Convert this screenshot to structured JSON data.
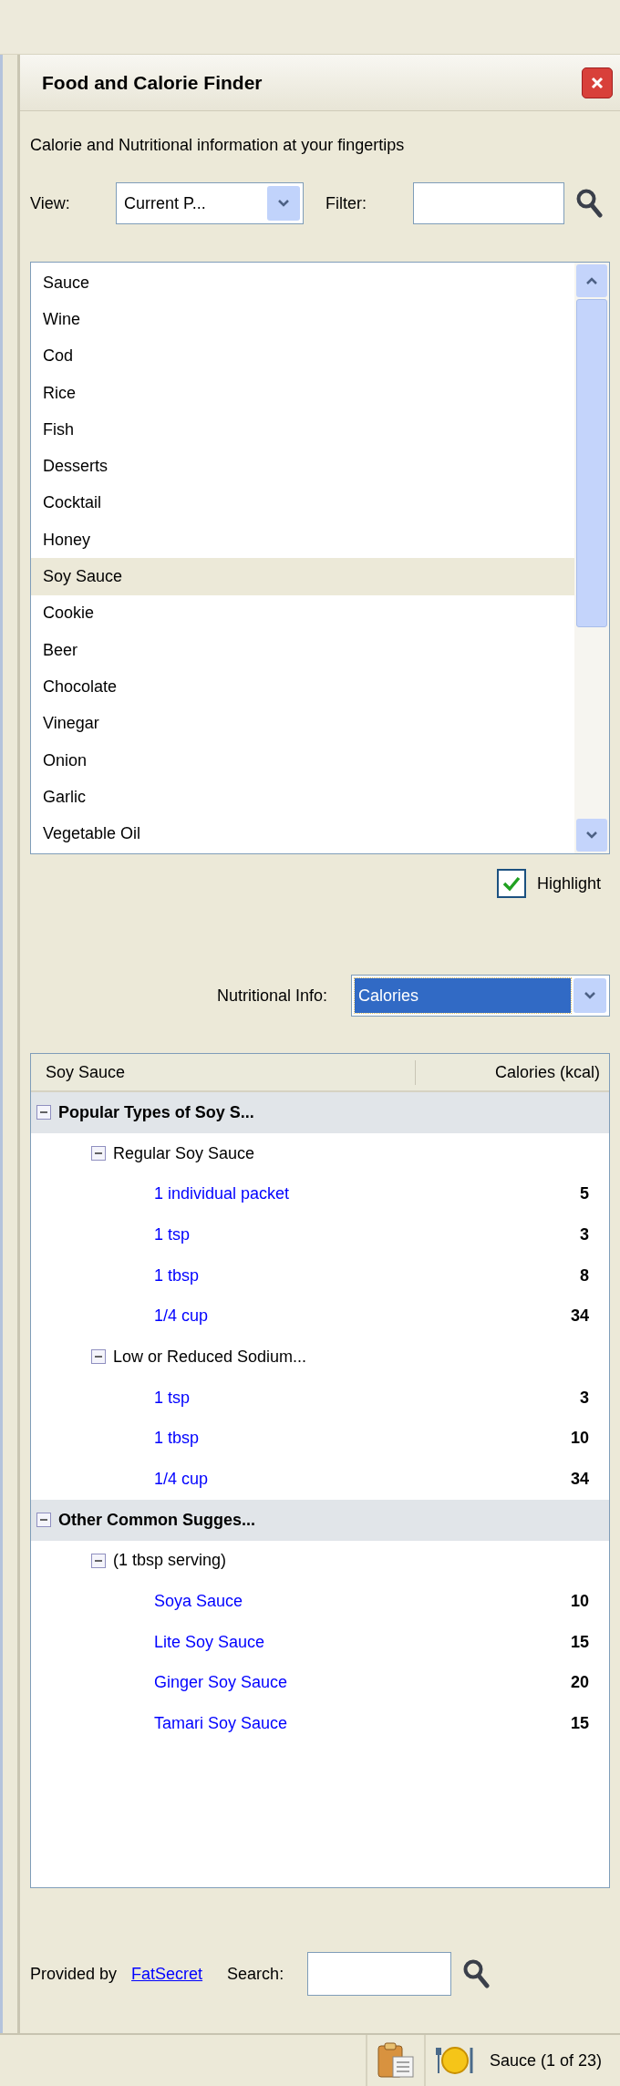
{
  "panel": {
    "title": "Food and Calorie Finder",
    "subtitle": "Calorie and Nutritional information at your fingertips"
  },
  "view": {
    "label": "View:",
    "value": "Current P..."
  },
  "filter": {
    "label": "Filter:"
  },
  "food_list": {
    "items": [
      {
        "label": "Sauce",
        "selected": false
      },
      {
        "label": "Wine",
        "selected": false
      },
      {
        "label": "Cod",
        "selected": false
      },
      {
        "label": "Rice",
        "selected": false
      },
      {
        "label": "Fish",
        "selected": false
      },
      {
        "label": "Desserts",
        "selected": false
      },
      {
        "label": "Cocktail",
        "selected": false
      },
      {
        "label": "Honey",
        "selected": false
      },
      {
        "label": "Soy Sauce",
        "selected": true
      },
      {
        "label": "Cookie",
        "selected": false
      },
      {
        "label": "Beer",
        "selected": false
      },
      {
        "label": "Chocolate",
        "selected": false
      },
      {
        "label": "Vinegar",
        "selected": false
      },
      {
        "label": "Onion",
        "selected": false
      },
      {
        "label": "Garlic",
        "selected": false
      },
      {
        "label": "Vegetable Oil",
        "selected": false
      }
    ]
  },
  "highlight": {
    "label": "Highlight",
    "checked": true
  },
  "nutritional_info": {
    "label": "Nutritional Info:",
    "value": "Calories"
  },
  "tree": {
    "columns": [
      "Soy Sauce",
      "Calories (kcal)"
    ],
    "items": [
      {
        "label": "Popular Types of Soy S...",
        "expanded": true,
        "children": [
          {
            "label": "Regular Soy Sauce",
            "expanded": true,
            "children": [
              {
                "label": "1 individual packet",
                "calories": "5"
              },
              {
                "label": "1 tsp",
                "calories": "3"
              },
              {
                "label": "1 tbsp",
                "calories": "8"
              },
              {
                "label": "1/4 cup",
                "calories": "34"
              }
            ]
          },
          {
            "label": "Low or Reduced Sodium...",
            "expanded": true,
            "children": [
              {
                "label": "1 tsp",
                "calories": "3"
              },
              {
                "label": "1 tbsp",
                "calories": "10"
              },
              {
                "label": "1/4 cup",
                "calories": "34"
              }
            ]
          }
        ]
      },
      {
        "label": "Other Common Sugges...",
        "expanded": true,
        "children": [
          {
            "label": "(1 tbsp serving)",
            "expanded": true,
            "children": [
              {
                "label": "Soya Sauce",
                "calories": "10"
              },
              {
                "label": "Lite Soy Sauce",
                "calories": "15"
              },
              {
                "label": "Ginger Soy Sauce",
                "calories": "20"
              },
              {
                "label": "Tamari Soy Sauce",
                "calories": "15"
              }
            ]
          }
        ]
      }
    ]
  },
  "footer": {
    "provided_by": "Provided by",
    "link": "FatSecret",
    "search_label": "Search:"
  },
  "status_bar": {
    "text": "Sauce (1 of 23)"
  }
}
